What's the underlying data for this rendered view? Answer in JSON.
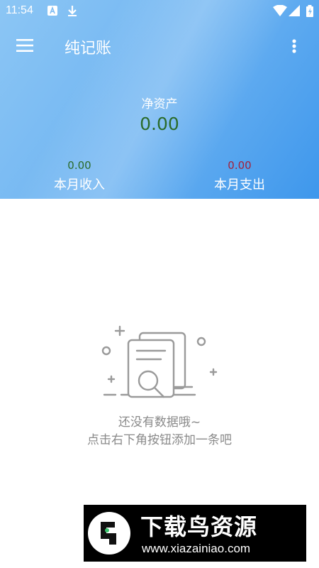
{
  "status_bar": {
    "time": "11:54",
    "icons": [
      "a-notification-icon",
      "download-icon",
      "wifi-icon",
      "signal-icon",
      "battery-icon"
    ]
  },
  "toolbar": {
    "title": "纯记账",
    "menu_icon": "hamburger-menu-icon",
    "more_icon": "more-vert-icon"
  },
  "summary": {
    "net_assets_label": "净资产",
    "net_assets_value": "0.00",
    "income_value": "0.00",
    "income_label": "本月收入",
    "expense_value": "0.00",
    "expense_label": "本月支出"
  },
  "empty_state": {
    "line1": "还没有数据哦~",
    "line2": "点击右下角按钮添加一条吧",
    "icon": "empty-document-search-icon"
  },
  "watermark": {
    "brand": "下载鸟资源",
    "url": "www.xiazainiao.com"
  },
  "colors": {
    "header_start": "#8cc6f4",
    "header_end": "#3e97ec",
    "income": "#2b6b2b",
    "expense": "#a2223c",
    "fab": "#f04b58"
  }
}
